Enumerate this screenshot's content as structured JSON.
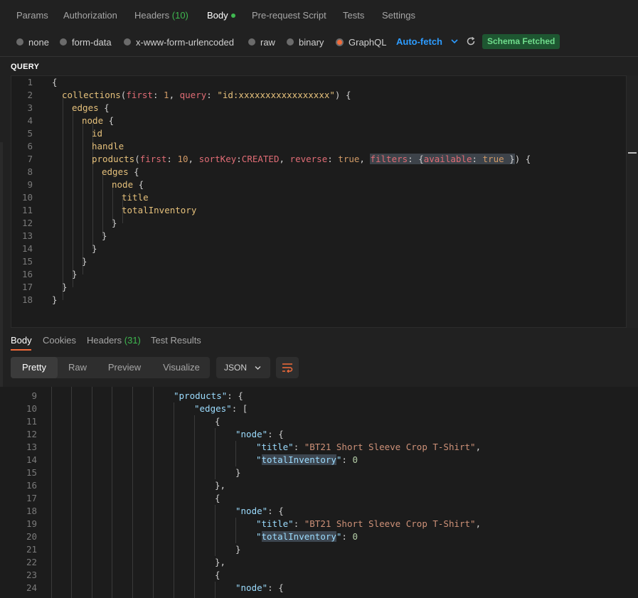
{
  "tabs": [
    {
      "label": "Params"
    },
    {
      "label": "Authorization"
    },
    {
      "label": "Headers",
      "count": "(10)"
    },
    {
      "label": "Body"
    },
    {
      "label": "Pre-request Script"
    },
    {
      "label": "Tests"
    },
    {
      "label": "Settings"
    }
  ],
  "body_types": [
    {
      "label": "none"
    },
    {
      "label": "form-data"
    },
    {
      "label": "x-www-form-urlencoded"
    },
    {
      "label": "raw"
    },
    {
      "label": "binary"
    },
    {
      "label": "GraphQL",
      "selected": true
    }
  ],
  "autofetch_label": "Auto-fetch",
  "schema_badge": "Schema Fetched",
  "query_label": "QUERY",
  "query_line_numbers": [
    "1",
    "2",
    "3",
    "4",
    "5",
    "6",
    "7",
    "8",
    "9",
    "10",
    "11",
    "12",
    "13",
    "14",
    "15",
    "16",
    "17",
    "18"
  ],
  "query": {
    "collections_field": "collections",
    "first_arg": "first",
    "first_val": "1",
    "query_arg": "query",
    "query_val": "\"id:xxxxxxxxxxxxxxxxx\"",
    "edges": "edges",
    "node": "node",
    "id": "id",
    "handle": "handle",
    "products": "products",
    "p_first": "first",
    "p_first_val": "10",
    "sortkey": "sortKey",
    "sortkey_val": "CREATED",
    "reverse": "reverse",
    "reverse_val": "true",
    "filters": "filters",
    "available": "available",
    "available_val": "true",
    "title": "title",
    "totalInventory": "totalInventory"
  },
  "response_tabs": [
    {
      "label": "Body"
    },
    {
      "label": "Cookies"
    },
    {
      "label": "Headers",
      "count": "(31)"
    },
    {
      "label": "Test Results"
    }
  ],
  "view_modes": [
    "Pretty",
    "Raw",
    "Preview",
    "Visualize"
  ],
  "format": "JSON",
  "response_line_numbers": [
    "9",
    "10",
    "11",
    "12",
    "13",
    "14",
    "15",
    "16",
    "17",
    "18",
    "19",
    "20",
    "21",
    "22",
    "23",
    "24"
  ],
  "response": {
    "products_key": "\"products\"",
    "edges_key": "\"edges\"",
    "node_key": "\"node\"",
    "title_key": "\"title\"",
    "title_val_1": "\"BT21 Short Sleeve Crop T-Shirt\"",
    "title_val_2": "\"BT21 Short Sleeve Crop T-Shirt\"",
    "inv_key_quote": "\"",
    "inv_key_name": "totalInventory",
    "inv_val_1": "0",
    "inv_val_2": "0"
  },
  "colors": {
    "accent": "#f26b3a",
    "link": "#2d9cff",
    "success": "#3fb950"
  }
}
